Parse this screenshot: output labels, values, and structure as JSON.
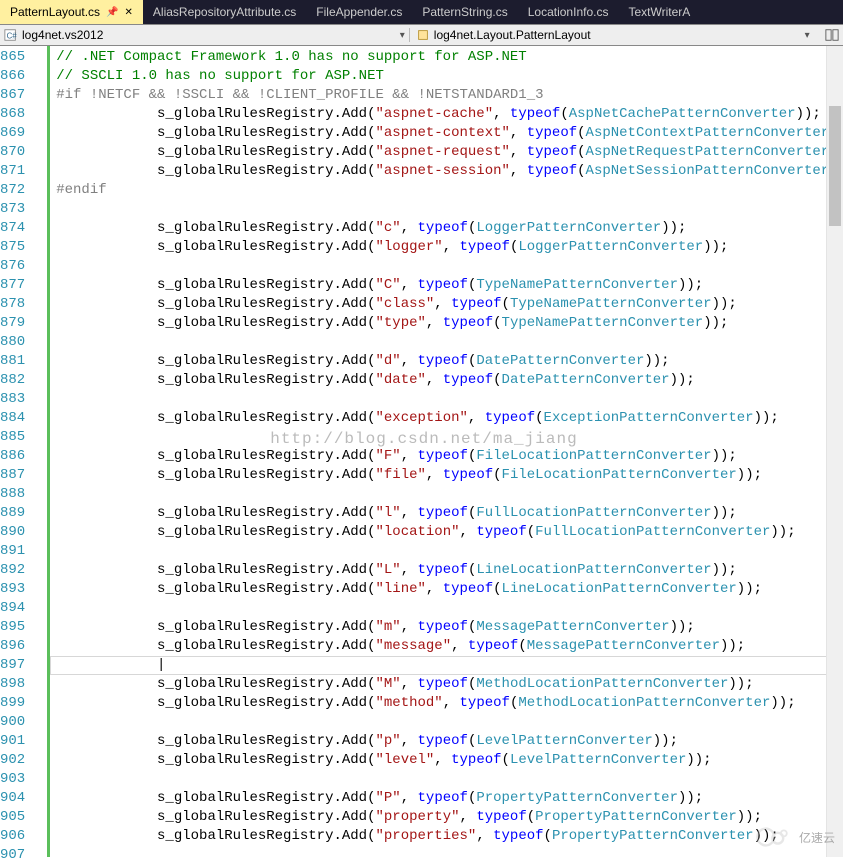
{
  "tabs": [
    {
      "label": "PatternLayout.cs",
      "active": true,
      "pinned": true
    },
    {
      "label": "AliasRepositoryAttribute.cs"
    },
    {
      "label": "FileAppender.cs"
    },
    {
      "label": "PatternString.cs"
    },
    {
      "label": "LocationInfo.cs"
    },
    {
      "label": "TextWriterA"
    }
  ],
  "crumb": {
    "left": "log4net.vs2012",
    "right": "log4net.Layout.PatternLayout"
  },
  "first_line": 865,
  "watermark": {
    "text_url": "http://blog.csdn.net/ma_jiang",
    "brand": "亿速云"
  },
  "code": [
    {
      "t": "comment",
      "txt": "// .NET Compact Framework 1.0 has no support for ASP.NET"
    },
    {
      "t": "comment",
      "txt": "// SSCLI 1.0 has no support for ASP.NET"
    },
    {
      "t": "prep",
      "txt": "#if !NETCF && !SSCLI && !CLIENT_PROFILE && !NETSTANDARD1_3"
    },
    {
      "t": "reg",
      "indent": "            ",
      "key": "aspnet-cache",
      "type": "AspNetCachePatternConverter"
    },
    {
      "t": "reg",
      "indent": "            ",
      "key": "aspnet-context",
      "type": "AspNetContextPatternConverter"
    },
    {
      "t": "reg",
      "indent": "            ",
      "key": "aspnet-request",
      "type": "AspNetRequestPatternConverter"
    },
    {
      "t": "reg",
      "indent": "            ",
      "key": "aspnet-session",
      "type": "AspNetSessionPatternConverter"
    },
    {
      "t": "prep",
      "txt": "#endif"
    },
    {
      "t": "blank"
    },
    {
      "t": "reg",
      "indent": "            ",
      "key": "c",
      "type": "LoggerPatternConverter"
    },
    {
      "t": "reg",
      "indent": "            ",
      "key": "logger",
      "type": "LoggerPatternConverter"
    },
    {
      "t": "blank"
    },
    {
      "t": "reg",
      "indent": "            ",
      "key": "C",
      "type": "TypeNamePatternConverter"
    },
    {
      "t": "reg",
      "indent": "            ",
      "key": "class",
      "type": "TypeNamePatternConverter"
    },
    {
      "t": "reg",
      "indent": "            ",
      "key": "type",
      "type": "TypeNamePatternConverter"
    },
    {
      "t": "blank"
    },
    {
      "t": "reg",
      "indent": "            ",
      "key": "d",
      "type": "DatePatternConverter"
    },
    {
      "t": "reg",
      "indent": "            ",
      "key": "date",
      "type": "DatePatternConverter"
    },
    {
      "t": "blank"
    },
    {
      "t": "reg",
      "indent": "            ",
      "key": "exception",
      "type": "ExceptionPatternConverter"
    },
    {
      "t": "blank"
    },
    {
      "t": "reg",
      "indent": "            ",
      "key": "F",
      "type": "FileLocationPatternConverter"
    },
    {
      "t": "reg",
      "indent": "            ",
      "key": "file",
      "type": "FileLocationPatternConverter"
    },
    {
      "t": "blank"
    },
    {
      "t": "reg",
      "indent": "            ",
      "key": "l",
      "type": "FullLocationPatternConverter"
    },
    {
      "t": "reg",
      "indent": "            ",
      "key": "location",
      "type": "FullLocationPatternConverter"
    },
    {
      "t": "blank"
    },
    {
      "t": "reg",
      "indent": "            ",
      "key": "L",
      "type": "LineLocationPatternConverter"
    },
    {
      "t": "reg",
      "indent": "            ",
      "key": "line",
      "type": "LineLocationPatternConverter"
    },
    {
      "t": "blank"
    },
    {
      "t": "reg",
      "indent": "            ",
      "key": "m",
      "type": "MessagePatternConverter"
    },
    {
      "t": "reg",
      "indent": "            ",
      "key": "message",
      "type": "MessagePatternConverter"
    },
    {
      "t": "cursor"
    },
    {
      "t": "reg",
      "indent": "            ",
      "key": "M",
      "type": "MethodLocationPatternConverter"
    },
    {
      "t": "reg",
      "indent": "            ",
      "key": "method",
      "type": "MethodLocationPatternConverter"
    },
    {
      "t": "blank"
    },
    {
      "t": "reg",
      "indent": "            ",
      "key": "p",
      "type": "LevelPatternConverter"
    },
    {
      "t": "reg",
      "indent": "            ",
      "key": "level",
      "type": "LevelPatternConverter"
    },
    {
      "t": "blank"
    },
    {
      "t": "reg",
      "indent": "            ",
      "key": "P",
      "type": "PropertyPatternConverter"
    },
    {
      "t": "reg",
      "indent": "            ",
      "key": "property",
      "type": "PropertyPatternConverter"
    },
    {
      "t": "reg",
      "indent": "            ",
      "key": "properties",
      "type": "PropertyPatternConverter"
    }
  ]
}
